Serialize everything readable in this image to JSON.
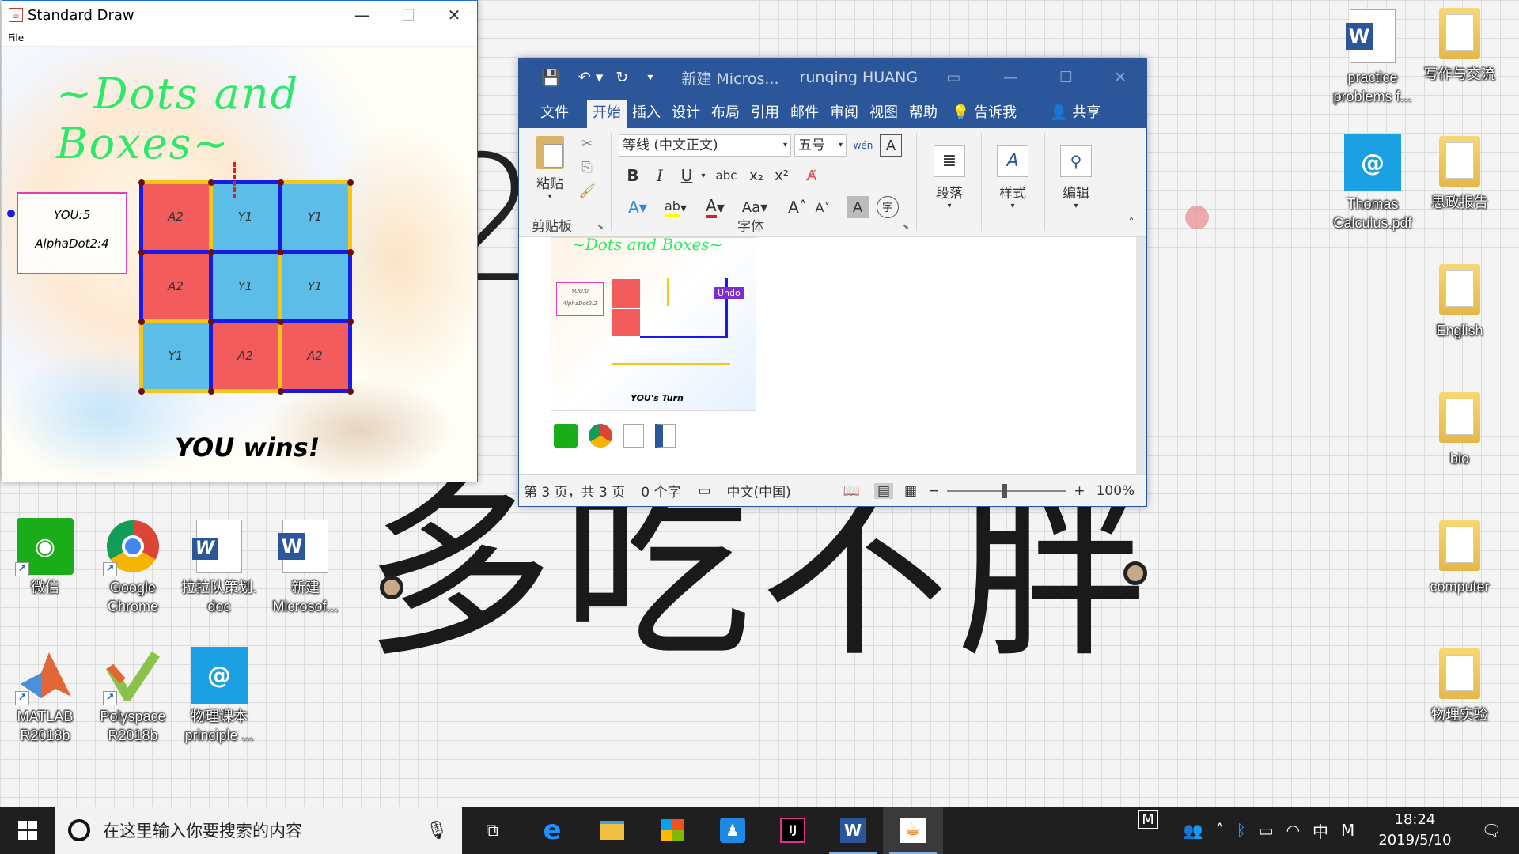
{
  "wallpaper": {
    "year": "2019",
    "motto": "多吃不胖"
  },
  "desktop_icons_left": [
    {
      "label": "微信",
      "icon": "wechat-icon",
      "color": "#1aad19"
    },
    {
      "label": "Google\nChrome",
      "icon": "chrome-icon",
      "color": "#4285f4"
    },
    {
      "label": "拉拉队策划.\ndoc",
      "icon": "word-doc-icon",
      "color": "#2b579a"
    },
    {
      "label": "新建\nMicrosof...",
      "icon": "word-icon",
      "color": "#2b579a"
    },
    {
      "label": "MATLAB\nR2018b",
      "icon": "matlab-icon",
      "color": "#e16737"
    },
    {
      "label": "Polyspace\nR2018b",
      "icon": "polyspace-icon",
      "color": "#8bc34a"
    },
    {
      "label": "物理课本\nprinciple ...",
      "icon": "pdf-reader-icon",
      "color": "#1ba1e2"
    }
  ],
  "desktop_icons_right": [
    {
      "label": "practice\nproblems f...",
      "icon": "word-icon"
    },
    {
      "label": "写作与交流",
      "icon": "folder-icon"
    },
    {
      "label": "Thomas\nCalculus.pdf",
      "icon": "pdf-reader-icon"
    },
    {
      "label": "思政报告",
      "icon": "folder-icon"
    },
    {
      "label": "English",
      "icon": "folder-icon"
    },
    {
      "label": "bio",
      "icon": "folder-icon"
    },
    {
      "label": "computer",
      "icon": "folder-icon"
    },
    {
      "label": "物理实验",
      "icon": "folder-icon"
    }
  ],
  "stddraw": {
    "title": "Standard Draw",
    "menu_file": "File",
    "game_title": "~Dots and Boxes~",
    "score_you": "YOU:5",
    "score_ai": "AlphaDot2:4",
    "cells": [
      "A2",
      "Y1",
      "Y1",
      "A2",
      "Y1",
      "Y1",
      "Y1",
      "A2",
      "A2"
    ],
    "cell_colors": {
      "A2": "#f25c5c",
      "Y1": "#5bbde8"
    },
    "result": "YOU wins!",
    "colors": {
      "title": "#2ee86c",
      "score_border": "#e040c0",
      "line_yellow": "#f5c518",
      "line_blue": "#1a1ae6"
    }
  },
  "word": {
    "doc_title": "新建 Micros...",
    "user": "runqing HUANG",
    "tabs": [
      "文件",
      "开始",
      "插入",
      "设计",
      "布局",
      "引用",
      "邮件",
      "审阅",
      "视图",
      "帮助"
    ],
    "active_tab": "开始",
    "tell_me": "告诉我",
    "share": "共享",
    "paste": "粘贴",
    "clipboard_group": "剪贴板",
    "font_name": "等线 (中文正文)",
    "font_size": "五号",
    "font_group": "字体",
    "paragraph": "段落",
    "styles": "样式",
    "editing": "编辑",
    "font_buttons": [
      "B",
      "I",
      "U",
      "abc",
      "x₂",
      "x²"
    ],
    "case_button": "Aa",
    "thumb_title": "~Dots and Boxes~",
    "thumb_you": "YOU:0",
    "thumb_ai": "AlphaDot2:2",
    "thumb_undo": "Undo",
    "thumb_turn": "YOU's Turn",
    "status_page": "第 3 页，共 3 页",
    "status_words": "0 个字",
    "status_lang": "中文(中国)",
    "zoom": "100%",
    "zoom_minus": "−",
    "zoom_plus": "+"
  },
  "taskbar": {
    "search_placeholder": "在这里输入你要搜索的内容",
    "time": "18:24",
    "date": "2019/5/10",
    "ime": "中",
    "ime_mode": "M"
  }
}
